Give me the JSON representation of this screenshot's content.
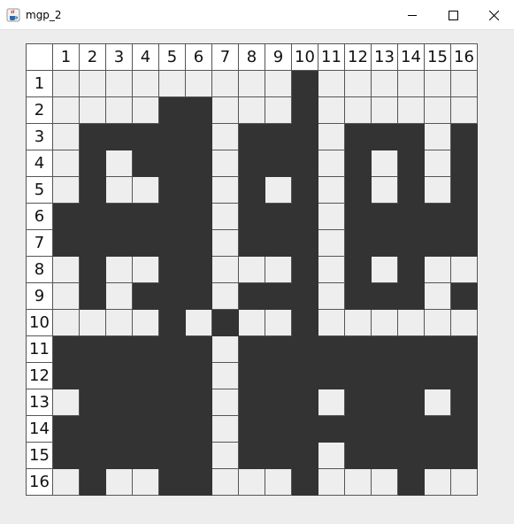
{
  "window": {
    "title": "mgp_2",
    "app_icon": "java-coffee-cup-icon",
    "controls": [
      "minimize-icon",
      "maximize-icon",
      "close-icon"
    ]
  },
  "grid": {
    "columns": [
      "1",
      "2",
      "3",
      "4",
      "5",
      "6",
      "7",
      "8",
      "9",
      "10",
      "11",
      "12",
      "13",
      "14",
      "15",
      "16"
    ],
    "rows": [
      "1",
      "2",
      "3",
      "4",
      "5",
      "6",
      "7",
      "8",
      "9",
      "10",
      "11",
      "12",
      "13",
      "14",
      "15",
      "16"
    ],
    "filled_color": "#333333",
    "empty_color": "#eeeeee",
    "cells": [
      "0000000001000000",
      "0000110001000000",
      "0111110111011101",
      "0101110111010101",
      "0100110101010101",
      "1111110111011111",
      "1111110111011111",
      "0100110001010100",
      "0101110111011101",
      "0000101001000000",
      "1111110111111111",
      "1111110111111111",
      "0111110111011101",
      "1111110111111111",
      "1111110111011111",
      "0100110001000100"
    ]
  }
}
